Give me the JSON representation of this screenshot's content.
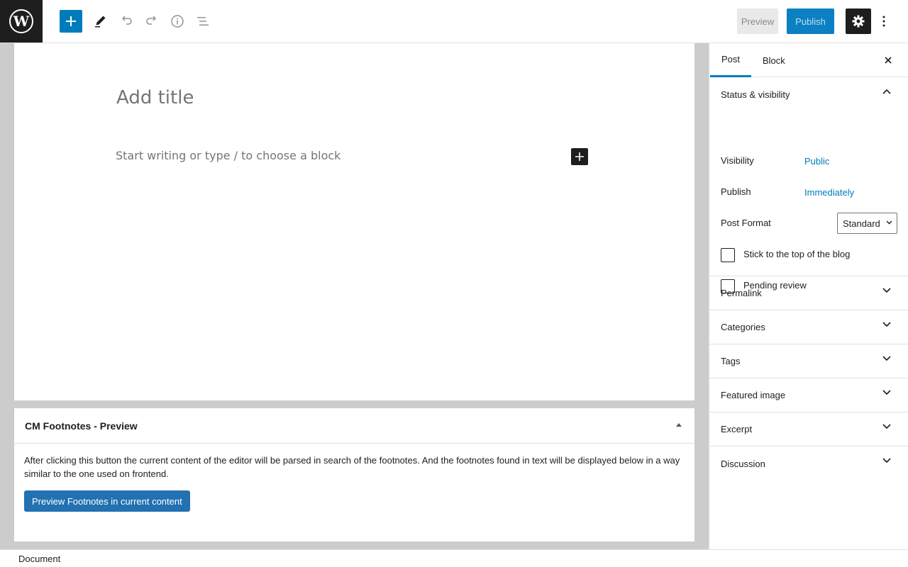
{
  "toolbar": {
    "preview_label": "Preview",
    "publish_label": "Publish"
  },
  "editor": {
    "title_placeholder": "Add title",
    "block_placeholder": "Start writing or type / to choose a block"
  },
  "metabox": {
    "title": "CM Footnotes - Preview",
    "description": "After clicking this button the current content of the editor will be parsed in search of the footnotes. And the footnotes found in text will be displayed below in a way similar to the one used on frontend.",
    "button_label": "Preview Footnotes in current content"
  },
  "sidebar": {
    "tabs": [
      {
        "label": "Post",
        "active": true
      },
      {
        "label": "Block",
        "active": false
      }
    ],
    "status_panel": {
      "title": "Status & visibility",
      "visibility_label": "Visibility",
      "visibility_value": "Public",
      "publish_label": "Publish",
      "publish_value": "Immediately",
      "post_format_label": "Post Format",
      "post_format_value": "Standard",
      "stick_label": "Stick to the top of the blog",
      "pending_label": "Pending review"
    },
    "panels": [
      {
        "label": "Permalink"
      },
      {
        "label": "Categories"
      },
      {
        "label": "Tags"
      },
      {
        "label": "Featured image"
      },
      {
        "label": "Excerpt"
      },
      {
        "label": "Discussion"
      }
    ]
  },
  "footer": {
    "breadcrumb": "Document"
  },
  "colors": {
    "accent": "#007cba",
    "dark": "#1e1e1e",
    "metabox_button": "#2271b1"
  }
}
